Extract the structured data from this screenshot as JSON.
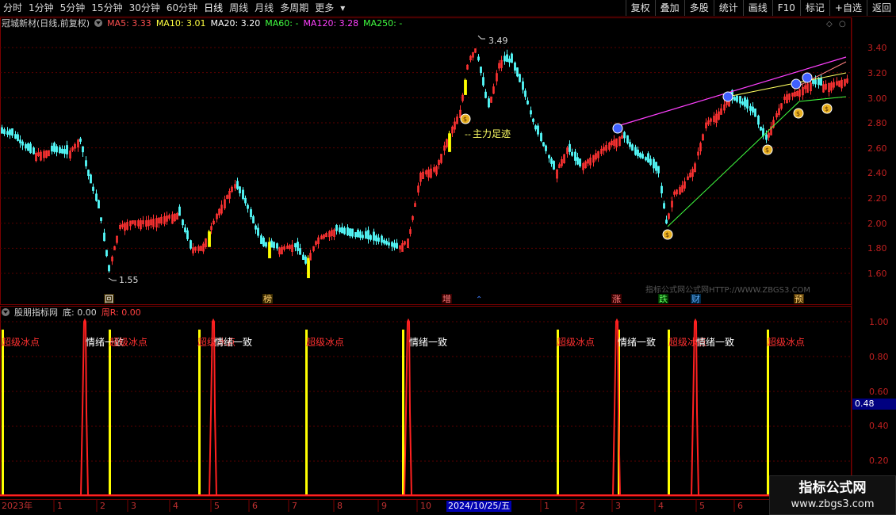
{
  "toolbar": {
    "periods": [
      "分时",
      "1分钟",
      "5分钟",
      "15分钟",
      "30分钟",
      "60分钟",
      "日线",
      "周线",
      "月线",
      "多周期",
      "更多"
    ],
    "active_period": "日线",
    "actions": [
      "复权",
      "叠加",
      "多股",
      "统计",
      "画线",
      "F10",
      "标记",
      "+自选",
      "返回"
    ]
  },
  "title_bar": {
    "stock_name": "冠城新材(日线,前复权)",
    "ma5": "MA5: 3.33",
    "ma10": "MA10: 3.01",
    "ma20": "MA20: 3.20",
    "ma60": "MA60: -",
    "ma120": "MA120: 3.28",
    "ma250": "MA250: -"
  },
  "main_chart": {
    "y_ticks": [
      "3.40",
      "3.20",
      "3.00",
      "2.80",
      "2.60",
      "2.40",
      "2.20",
      "2.00",
      "1.80",
      "1.60"
    ],
    "high_label": "3.49",
    "low_label": "1.55",
    "annotation": "主力足迹",
    "watermark": "指标公式网公式网HTTP://WWW.ZBGS3.COM",
    "event_markers": [
      "回",
      "榜",
      "增",
      "涨",
      "跌",
      "财",
      "预"
    ],
    "colors": {
      "up": "#ff3232",
      "down": "#54fcfc",
      "ma5": "#ffffff",
      "ma10": "#ffff00",
      "ma20": "#ff00ff",
      "ma120": "#ff40ff"
    }
  },
  "sub_chart": {
    "indicator_name": "股朋指标网",
    "bottom_label": "底: 0.00",
    "week_label": "周R: 0.00",
    "y_ticks": [
      "1.00",
      "0.80",
      "0.60",
      "0.40",
      "0.20"
    ],
    "current_value": "0.48",
    "signal_cold": "超级冰点",
    "signal_sync": "情绪一致"
  },
  "x_axis": {
    "labels": [
      "2023年",
      "1",
      "2",
      "3",
      "4",
      "5",
      "6",
      "7",
      "8",
      "9",
      "10",
      "1",
      "2",
      "3",
      "4",
      "5",
      "6"
    ],
    "cursor_date": "2024/10/25/五"
  },
  "brand": {
    "name": "指标公式网",
    "url": "www.zbgs3.com"
  }
}
